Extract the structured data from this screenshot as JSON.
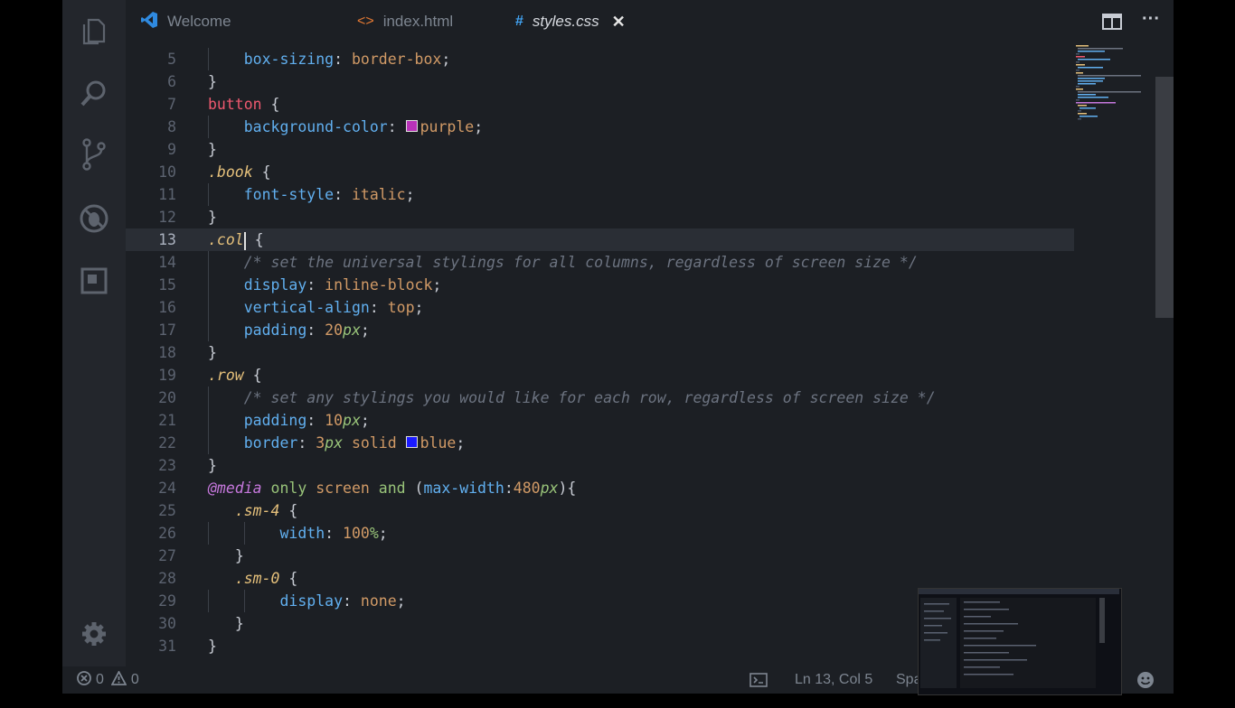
{
  "tabs": [
    {
      "label": "Welcome",
      "icon": "vscode-logo-icon"
    },
    {
      "label": "index.html",
      "icon": "html-brackets-icon"
    },
    {
      "label": "styles.css",
      "icon": "hash-icon",
      "active": true
    }
  ],
  "activity_icons": [
    "files-icon",
    "search-icon",
    "source-control-icon",
    "debug-icon",
    "extensions-icon",
    "settings-icon"
  ],
  "editor": {
    "lines": [
      {
        "n": "5",
        "indent": 1,
        "tokens": [
          [
            "prop",
            "box-sizing"
          ],
          [
            "punc",
            ": "
          ],
          [
            "val",
            "border-box"
          ],
          [
            "punc",
            ";"
          ]
        ]
      },
      {
        "n": "6",
        "indent": 0,
        "tokens": [
          [
            "punc",
            "}"
          ]
        ]
      },
      {
        "n": "7",
        "indent": 0,
        "tokens": [
          [
            "selel",
            "button"
          ],
          [
            "punc",
            " {"
          ]
        ]
      },
      {
        "n": "8",
        "indent": 1,
        "tokens": [
          [
            "prop",
            "background-color"
          ],
          [
            "punc",
            ": "
          ],
          [
            "swatch",
            "#b832b8"
          ],
          [
            "val",
            "purple"
          ],
          [
            "punc",
            ";"
          ]
        ]
      },
      {
        "n": "9",
        "indent": 0,
        "tokens": [
          [
            "punc",
            "}"
          ]
        ]
      },
      {
        "n": "10",
        "indent": 0,
        "tokens": [
          [
            "selcls",
            ".book"
          ],
          [
            "punc",
            " {"
          ]
        ]
      },
      {
        "n": "11",
        "indent": 1,
        "tokens": [
          [
            "prop",
            "font-style"
          ],
          [
            "punc",
            ": "
          ],
          [
            "val",
            "italic"
          ],
          [
            "punc",
            ";"
          ]
        ]
      },
      {
        "n": "12",
        "indent": 0,
        "tokens": [
          [
            "punc",
            "}"
          ]
        ]
      },
      {
        "n": "13",
        "indent": 0,
        "current": true,
        "tokens": [
          [
            "selcls",
            ".col"
          ],
          [
            "cursor",
            ""
          ],
          [
            "punc",
            " {"
          ]
        ]
      },
      {
        "n": "14",
        "indent": 1,
        "tokens": [
          [
            "comment",
            "/* set the universal stylings for all columns, regardless of screen size */"
          ]
        ]
      },
      {
        "n": "15",
        "indent": 1,
        "tokens": [
          [
            "prop",
            "display"
          ],
          [
            "punc",
            ": "
          ],
          [
            "val",
            "inline-block"
          ],
          [
            "punc",
            ";"
          ]
        ]
      },
      {
        "n": "16",
        "indent": 1,
        "tokens": [
          [
            "prop",
            "vertical-align"
          ],
          [
            "punc",
            ": "
          ],
          [
            "val",
            "top"
          ],
          [
            "punc",
            ";"
          ]
        ]
      },
      {
        "n": "17",
        "indent": 1,
        "tokens": [
          [
            "prop",
            "padding"
          ],
          [
            "punc",
            ": "
          ],
          [
            "num",
            "20"
          ],
          [
            "unit",
            "px"
          ],
          [
            "punc",
            ";"
          ]
        ]
      },
      {
        "n": "18",
        "indent": 0,
        "tokens": [
          [
            "punc",
            "}"
          ]
        ]
      },
      {
        "n": "19",
        "indent": 0,
        "tokens": [
          [
            "selcls",
            ".row"
          ],
          [
            "punc",
            " {"
          ]
        ]
      },
      {
        "n": "20",
        "indent": 1,
        "tokens": [
          [
            "comment",
            "/* set any stylings you would like for each row, regardless of screen size */"
          ]
        ]
      },
      {
        "n": "21",
        "indent": 1,
        "tokens": [
          [
            "prop",
            "padding"
          ],
          [
            "punc",
            ": "
          ],
          [
            "num",
            "10"
          ],
          [
            "unit",
            "px"
          ],
          [
            "punc",
            ";"
          ]
        ]
      },
      {
        "n": "22",
        "indent": 1,
        "tokens": [
          [
            "prop",
            "border"
          ],
          [
            "punc",
            ": "
          ],
          [
            "num",
            "3"
          ],
          [
            "unit",
            "px"
          ],
          [
            "val",
            " solid "
          ],
          [
            "swatch",
            "#1a1aff"
          ],
          [
            "val",
            "blue"
          ],
          [
            "punc",
            ";"
          ]
        ]
      },
      {
        "n": "23",
        "indent": 0,
        "tokens": [
          [
            "punc",
            "}"
          ]
        ]
      },
      {
        "n": "24",
        "indent": 0,
        "tokens": [
          [
            "at",
            "@media"
          ],
          [
            "kw",
            " only "
          ],
          [
            "val",
            "screen "
          ],
          [
            "kw",
            "and"
          ],
          [
            "punc",
            " ("
          ],
          [
            "prop",
            "max-width"
          ],
          [
            "punc",
            ":"
          ],
          [
            "num",
            "480"
          ],
          [
            "unit",
            "px"
          ],
          [
            "punc",
            "){"
          ]
        ]
      },
      {
        "n": "25",
        "indent": 0,
        "pre": "   ",
        "tokens": [
          [
            "selcls",
            ".sm-4"
          ],
          [
            "punc",
            " {"
          ]
        ]
      },
      {
        "n": "26",
        "indent": 2,
        "tokens": [
          [
            "prop",
            "width"
          ],
          [
            "punc",
            ": "
          ],
          [
            "num",
            "100"
          ],
          [
            "unit",
            "%"
          ],
          [
            "punc",
            ";"
          ]
        ]
      },
      {
        "n": "27",
        "indent": 0,
        "pre": "   ",
        "tokens": [
          [
            "punc",
            "}"
          ]
        ]
      },
      {
        "n": "28",
        "indent": 0,
        "pre": "   ",
        "tokens": [
          [
            "selcls",
            ".sm-0"
          ],
          [
            "punc",
            " {"
          ]
        ]
      },
      {
        "n": "29",
        "indent": 2,
        "tokens": [
          [
            "prop",
            "display"
          ],
          [
            "punc",
            ": "
          ],
          [
            "val",
            "none"
          ],
          [
            "punc",
            ";"
          ]
        ]
      },
      {
        "n": "30",
        "indent": 0,
        "pre": "   ",
        "tokens": [
          [
            "punc",
            "}"
          ]
        ]
      },
      {
        "n": "31",
        "indent": 0,
        "tokens": [
          [
            "punc",
            "}"
          ]
        ]
      }
    ]
  },
  "status": {
    "errors": "0",
    "warnings": "0",
    "position": "Ln 13, Col 5",
    "spaces": "Spa"
  }
}
